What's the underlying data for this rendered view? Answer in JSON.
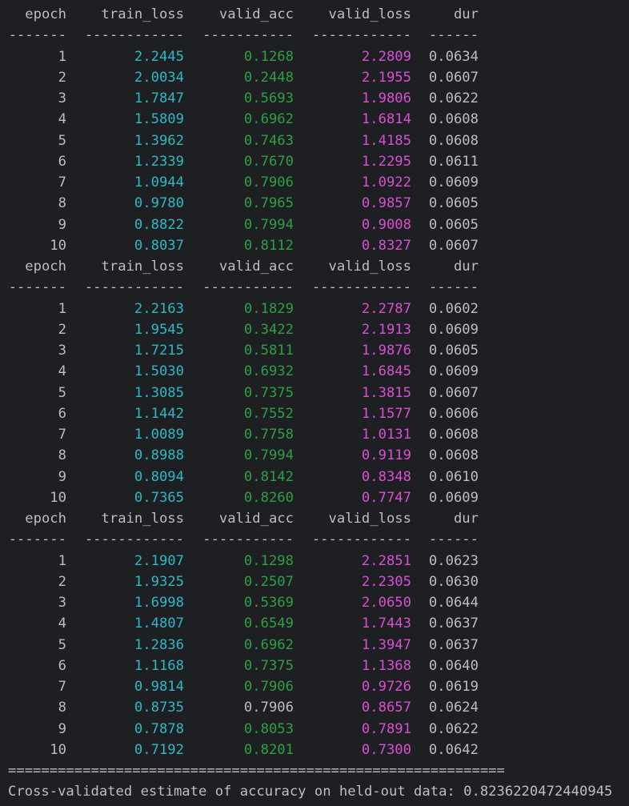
{
  "console": {
    "blocks": [
      {
        "header": {
          "epoch": "epoch",
          "train_loss": "train_loss",
          "valid_acc": "valid_acc",
          "valid_loss": "valid_loss",
          "dur": "dur"
        },
        "divider": {
          "epoch": "-------",
          "train_loss": "------------",
          "valid_acc": "-----------",
          "valid_loss": "------------",
          "dur": "------"
        },
        "rows": [
          {
            "epoch": "1",
            "train_loss": "2.2445",
            "valid_acc": "0.1268",
            "valid_loss": "2.2809",
            "dur": "0.0634",
            "acc_best": true,
            "loss_best": true
          },
          {
            "epoch": "2",
            "train_loss": "2.0034",
            "valid_acc": "0.2448",
            "valid_loss": "2.1955",
            "dur": "0.0607",
            "acc_best": true,
            "loss_best": true
          },
          {
            "epoch": "3",
            "train_loss": "1.7847",
            "valid_acc": "0.5693",
            "valid_loss": "1.9806",
            "dur": "0.0622",
            "acc_best": true,
            "loss_best": true
          },
          {
            "epoch": "4",
            "train_loss": "1.5809",
            "valid_acc": "0.6962",
            "valid_loss": "1.6814",
            "dur": "0.0608",
            "acc_best": true,
            "loss_best": true
          },
          {
            "epoch": "5",
            "train_loss": "1.3962",
            "valid_acc": "0.7463",
            "valid_loss": "1.4185",
            "dur": "0.0608",
            "acc_best": true,
            "loss_best": true
          },
          {
            "epoch": "6",
            "train_loss": "1.2339",
            "valid_acc": "0.7670",
            "valid_loss": "1.2295",
            "dur": "0.0611",
            "acc_best": true,
            "loss_best": true
          },
          {
            "epoch": "7",
            "train_loss": "1.0944",
            "valid_acc": "0.7906",
            "valid_loss": "1.0922",
            "dur": "0.0609",
            "acc_best": true,
            "loss_best": true
          },
          {
            "epoch": "8",
            "train_loss": "0.9780",
            "valid_acc": "0.7965",
            "valid_loss": "0.9857",
            "dur": "0.0605",
            "acc_best": true,
            "loss_best": true
          },
          {
            "epoch": "9",
            "train_loss": "0.8822",
            "valid_acc": "0.7994",
            "valid_loss": "0.9008",
            "dur": "0.0605",
            "acc_best": true,
            "loss_best": true
          },
          {
            "epoch": "10",
            "train_loss": "0.8037",
            "valid_acc": "0.8112",
            "valid_loss": "0.8327",
            "dur": "0.0607",
            "acc_best": true,
            "loss_best": true
          }
        ]
      },
      {
        "header": {
          "epoch": "epoch",
          "train_loss": "train_loss",
          "valid_acc": "valid_acc",
          "valid_loss": "valid_loss",
          "dur": "dur"
        },
        "divider": {
          "epoch": "-------",
          "train_loss": "------------",
          "valid_acc": "-----------",
          "valid_loss": "------------",
          "dur": "------"
        },
        "rows": [
          {
            "epoch": "1",
            "train_loss": "2.2163",
            "valid_acc": "0.1829",
            "valid_loss": "2.2787",
            "dur": "0.0602",
            "acc_best": true,
            "loss_best": true
          },
          {
            "epoch": "2",
            "train_loss": "1.9545",
            "valid_acc": "0.3422",
            "valid_loss": "2.1913",
            "dur": "0.0609",
            "acc_best": true,
            "loss_best": true
          },
          {
            "epoch": "3",
            "train_loss": "1.7215",
            "valid_acc": "0.5811",
            "valid_loss": "1.9876",
            "dur": "0.0605",
            "acc_best": true,
            "loss_best": true
          },
          {
            "epoch": "4",
            "train_loss": "1.5030",
            "valid_acc": "0.6932",
            "valid_loss": "1.6845",
            "dur": "0.0609",
            "acc_best": true,
            "loss_best": true
          },
          {
            "epoch": "5",
            "train_loss": "1.3085",
            "valid_acc": "0.7375",
            "valid_loss": "1.3815",
            "dur": "0.0607",
            "acc_best": true,
            "loss_best": true
          },
          {
            "epoch": "6",
            "train_loss": "1.1442",
            "valid_acc": "0.7552",
            "valid_loss": "1.1577",
            "dur": "0.0606",
            "acc_best": true,
            "loss_best": true
          },
          {
            "epoch": "7",
            "train_loss": "1.0089",
            "valid_acc": "0.7758",
            "valid_loss": "1.0131",
            "dur": "0.0608",
            "acc_best": true,
            "loss_best": true
          },
          {
            "epoch": "8",
            "train_loss": "0.8988",
            "valid_acc": "0.7994",
            "valid_loss": "0.9119",
            "dur": "0.0608",
            "acc_best": true,
            "loss_best": true
          },
          {
            "epoch": "9",
            "train_loss": "0.8094",
            "valid_acc": "0.8142",
            "valid_loss": "0.8348",
            "dur": "0.0610",
            "acc_best": true,
            "loss_best": true
          },
          {
            "epoch": "10",
            "train_loss": "0.7365",
            "valid_acc": "0.8260",
            "valid_loss": "0.7747",
            "dur": "0.0609",
            "acc_best": true,
            "loss_best": true
          }
        ]
      },
      {
        "header": {
          "epoch": "epoch",
          "train_loss": "train_loss",
          "valid_acc": "valid_acc",
          "valid_loss": "valid_loss",
          "dur": "dur"
        },
        "divider": {
          "epoch": "-------",
          "train_loss": "------------",
          "valid_acc": "-----------",
          "valid_loss": "------------",
          "dur": "------"
        },
        "rows": [
          {
            "epoch": "1",
            "train_loss": "2.1907",
            "valid_acc": "0.1298",
            "valid_loss": "2.2851",
            "dur": "0.0623",
            "acc_best": true,
            "loss_best": true
          },
          {
            "epoch": "2",
            "train_loss": "1.9325",
            "valid_acc": "0.2507",
            "valid_loss": "2.2305",
            "dur": "0.0630",
            "acc_best": true,
            "loss_best": true
          },
          {
            "epoch": "3",
            "train_loss": "1.6998",
            "valid_acc": "0.5369",
            "valid_loss": "2.0650",
            "dur": "0.0644",
            "acc_best": true,
            "loss_best": true
          },
          {
            "epoch": "4",
            "train_loss": "1.4807",
            "valid_acc": "0.6549",
            "valid_loss": "1.7443",
            "dur": "0.0637",
            "acc_best": true,
            "loss_best": true
          },
          {
            "epoch": "5",
            "train_loss": "1.2836",
            "valid_acc": "0.6962",
            "valid_loss": "1.3947",
            "dur": "0.0637",
            "acc_best": true,
            "loss_best": true
          },
          {
            "epoch": "6",
            "train_loss": "1.1168",
            "valid_acc": "0.7375",
            "valid_loss": "1.1368",
            "dur": "0.0640",
            "acc_best": true,
            "loss_best": true
          },
          {
            "epoch": "7",
            "train_loss": "0.9814",
            "valid_acc": "0.7906",
            "valid_loss": "0.9726",
            "dur": "0.0619",
            "acc_best": true,
            "loss_best": true
          },
          {
            "epoch": "8",
            "train_loss": "0.8735",
            "valid_acc": "0.7906",
            "valid_loss": "0.8657",
            "dur": "0.0624",
            "acc_best": false,
            "loss_best": true
          },
          {
            "epoch": "9",
            "train_loss": "0.7878",
            "valid_acc": "0.8053",
            "valid_loss": "0.7891",
            "dur": "0.0622",
            "acc_best": true,
            "loss_best": true
          },
          {
            "epoch": "10",
            "train_loss": "0.7192",
            "valid_acc": "0.8201",
            "valid_loss": "0.7300",
            "dur": "0.0642",
            "acc_best": true,
            "loss_best": true
          }
        ]
      }
    ],
    "separator": "============================================================",
    "final_message": "Cross-validated estimate of accuracy on held-out data: 0.8236220472440945"
  },
  "colors": {
    "background": "#1e1f22",
    "text": "#bcbec4",
    "train_loss": "#2fb8c5",
    "valid_acc_best": "#2ea043",
    "valid_loss_best": "#d94fd4"
  }
}
